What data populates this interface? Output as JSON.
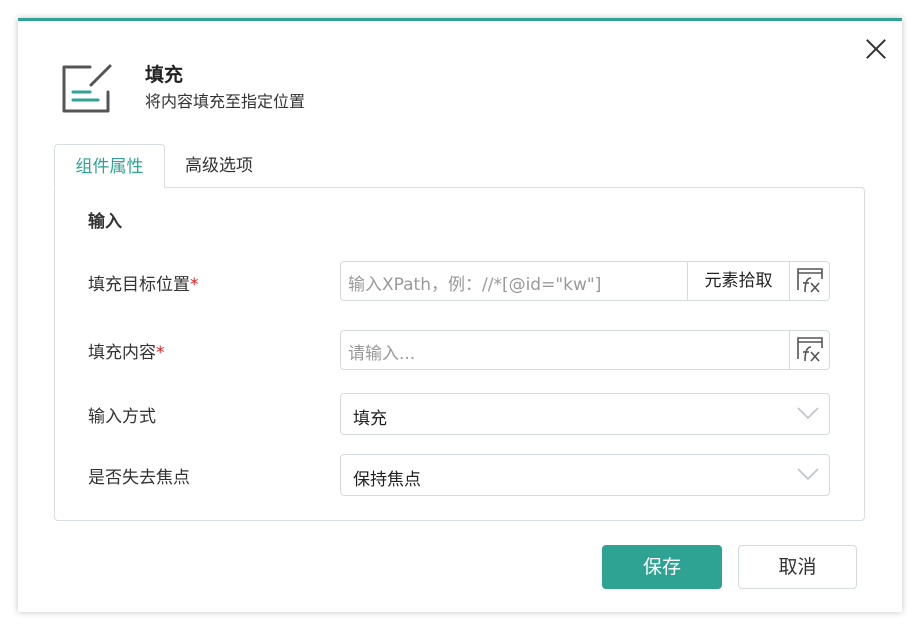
{
  "dialog": {
    "title": "填充",
    "subtitle": "将内容填充至指定位置",
    "icon": "edit-form-icon",
    "close_icon": "close-icon"
  },
  "tabs": [
    {
      "label": "组件属性",
      "active": true
    },
    {
      "label": "高级选项",
      "active": false
    }
  ],
  "section": {
    "title": "输入"
  },
  "fields": {
    "target": {
      "label": "填充目标位置",
      "required_mark": "*",
      "placeholder": "输入XPath，例：//*[@id=\"kw\"]",
      "pick_button": "元素拾取",
      "fx_icon": "fx-formula-icon"
    },
    "content": {
      "label": "填充内容",
      "required_mark": "*",
      "placeholder": "请输入...",
      "fx_icon": "fx-formula-icon"
    },
    "input_mode": {
      "label": "输入方式",
      "value": "填充"
    },
    "blur": {
      "label": "是否失去焦点",
      "value": "保持焦点"
    }
  },
  "footer": {
    "save_label": "保存",
    "cancel_label": "取消"
  },
  "colors": {
    "accent": "#2fa393",
    "required": "#e02020"
  }
}
